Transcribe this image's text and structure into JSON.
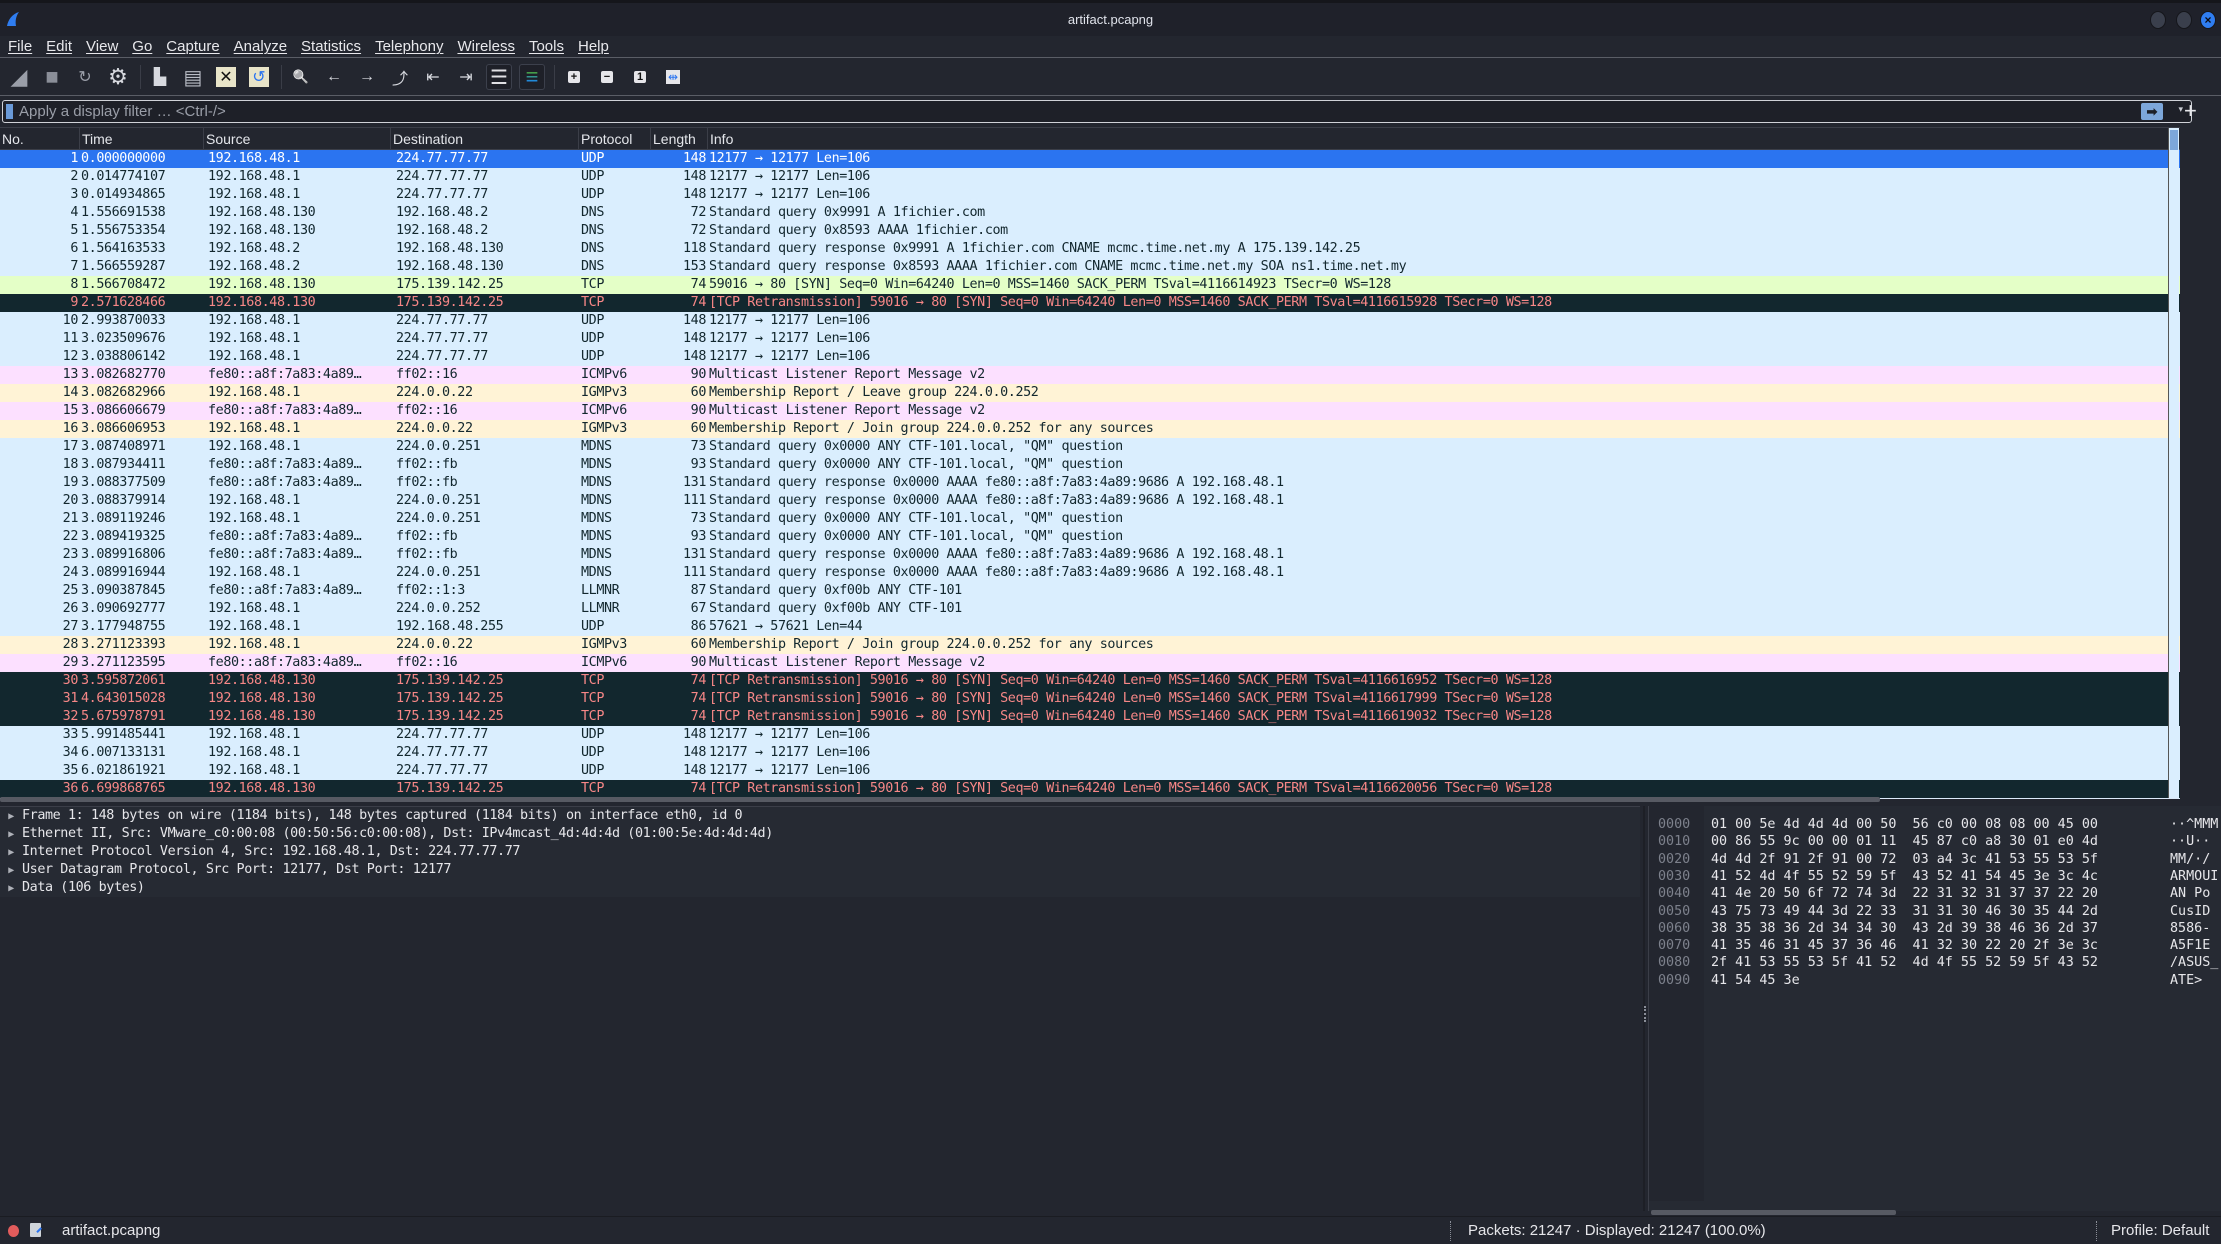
{
  "window": {
    "title": "artifact.pcapng"
  },
  "menu": [
    "File",
    "Edit",
    "View",
    "Go",
    "Capture",
    "Analyze",
    "Statistics",
    "Telephony",
    "Wireless",
    "Tools",
    "Help"
  ],
  "toolbar": [
    {
      "name": "start-capture-icon",
      "glyph": "◢"
    },
    {
      "name": "stop-capture-icon",
      "glyph": "■"
    },
    {
      "name": "restart-capture-icon",
      "glyph": "↻"
    },
    {
      "name": "capture-options-icon",
      "glyph": "⚙"
    },
    {
      "name": "open-file-icon",
      "glyph": "▙"
    },
    {
      "name": "save-file-icon",
      "glyph": "▤"
    },
    {
      "name": "close-file-icon",
      "glyph": "✕"
    },
    {
      "name": "reload-file-icon",
      "glyph": "↺"
    },
    {
      "name": "find-packet-icon",
      "glyph": "🔍"
    },
    {
      "name": "go-back-icon",
      "glyph": "←"
    },
    {
      "name": "go-forward-icon",
      "glyph": "→"
    },
    {
      "name": "go-to-packet-icon",
      "glyph": "⤴"
    },
    {
      "name": "go-first-packet-icon",
      "glyph": "⇤"
    },
    {
      "name": "go-last-packet-icon",
      "glyph": "⇥"
    },
    {
      "name": "autoscroll-icon",
      "glyph": "☰"
    },
    {
      "name": "colorize-icon",
      "glyph": "≡"
    },
    {
      "name": "zoom-in-icon",
      "glyph": "+"
    },
    {
      "name": "zoom-out-icon",
      "glyph": "−"
    },
    {
      "name": "zoom-normal-icon",
      "glyph": "1"
    },
    {
      "name": "resize-columns-icon",
      "glyph": "⇹"
    }
  ],
  "filter": {
    "placeholder": "Apply a display filter … <Ctrl-/>",
    "value": "",
    "apply_glyph": "➡",
    "dropdown_glyph": "▾",
    "add_glyph": "+"
  },
  "columns": [
    "No.",
    "Time",
    "Source",
    "Destination",
    "Protocol",
    "Length",
    "Info"
  ],
  "packets": [
    {
      "no": "1",
      "time": "0.000000000",
      "src": "192.168.48.1",
      "dst": "224.77.77.77",
      "proto": "UDP",
      "len": "148",
      "info": "12177 → 12177 Len=106",
      "cls": "udp sel"
    },
    {
      "no": "2",
      "time": "0.014774107",
      "src": "192.168.48.1",
      "dst": "224.77.77.77",
      "proto": "UDP",
      "len": "148",
      "info": "12177 → 12177 Len=106",
      "cls": "udp"
    },
    {
      "no": "3",
      "time": "0.014934865",
      "src": "192.168.48.1",
      "dst": "224.77.77.77",
      "proto": "UDP",
      "len": "148",
      "info": "12177 → 12177 Len=106",
      "cls": "udp"
    },
    {
      "no": "4",
      "time": "1.556691538",
      "src": "192.168.48.130",
      "dst": "192.168.48.2",
      "proto": "DNS",
      "len": "72",
      "info": "Standard query 0x9991 A 1fichier.com",
      "cls": "dns"
    },
    {
      "no": "5",
      "time": "1.556753354",
      "src": "192.168.48.130",
      "dst": "192.168.48.2",
      "proto": "DNS",
      "len": "72",
      "info": "Standard query 0x8593 AAAA 1fichier.com",
      "cls": "dns"
    },
    {
      "no": "6",
      "time": "1.564163533",
      "src": "192.168.48.2",
      "dst": "192.168.48.130",
      "proto": "DNS",
      "len": "118",
      "info": "Standard query response 0x9991 A 1fichier.com CNAME mcmc.time.net.my A 175.139.142.25",
      "cls": "dns"
    },
    {
      "no": "7",
      "time": "1.566559287",
      "src": "192.168.48.2",
      "dst": "192.168.48.130",
      "proto": "DNS",
      "len": "153",
      "info": "Standard query response 0x8593 AAAA 1fichier.com CNAME mcmc.time.net.my SOA ns1.time.net.my",
      "cls": "dns"
    },
    {
      "no": "8",
      "time": "1.566708472",
      "src": "192.168.48.130",
      "dst": "175.139.142.25",
      "proto": "TCP",
      "len": "74",
      "info": "59016 → 80 [SYN] Seq=0 Win=64240 Len=0 MSS=1460 SACK_PERM TSval=4116614923 TSecr=0 WS=128",
      "cls": "tcp"
    },
    {
      "no": "9",
      "time": "2.571628466",
      "src": "192.168.48.130",
      "dst": "175.139.142.25",
      "proto": "TCP",
      "len": "74",
      "info": "[TCP Retransmission] 59016 → 80 [SYN] Seq=0 Win=64240 Len=0 MSS=1460 SACK_PERM TSval=4116615928 TSecr=0 WS=128",
      "cls": "bad"
    },
    {
      "no": "10",
      "time": "2.993870033",
      "src": "192.168.48.1",
      "dst": "224.77.77.77",
      "proto": "UDP",
      "len": "148",
      "info": "12177 → 12177 Len=106",
      "cls": "udp"
    },
    {
      "no": "11",
      "time": "3.023509676",
      "src": "192.168.48.1",
      "dst": "224.77.77.77",
      "proto": "UDP",
      "len": "148",
      "info": "12177 → 12177 Len=106",
      "cls": "udp"
    },
    {
      "no": "12",
      "time": "3.038806142",
      "src": "192.168.48.1",
      "dst": "224.77.77.77",
      "proto": "UDP",
      "len": "148",
      "info": "12177 → 12177 Len=106",
      "cls": "udp"
    },
    {
      "no": "13",
      "time": "3.082682770",
      "src": "fe80::a8f:7a83:4a89…",
      "dst": "ff02::16",
      "proto": "ICMPv6",
      "len": "90",
      "info": "Multicast Listener Report Message v2",
      "cls": "icmpv6"
    },
    {
      "no": "14",
      "time": "3.082682966",
      "src": "192.168.48.1",
      "dst": "224.0.0.22",
      "proto": "IGMPv3",
      "len": "60",
      "info": "Membership Report / Leave group 224.0.0.252",
      "cls": "igmp"
    },
    {
      "no": "15",
      "time": "3.086606679",
      "src": "fe80::a8f:7a83:4a89…",
      "dst": "ff02::16",
      "proto": "ICMPv6",
      "len": "90",
      "info": "Multicast Listener Report Message v2",
      "cls": "icmpv6"
    },
    {
      "no": "16",
      "time": "3.086606953",
      "src": "192.168.48.1",
      "dst": "224.0.0.22",
      "proto": "IGMPv3",
      "len": "60",
      "info": "Membership Report / Join group 224.0.0.252 for any sources",
      "cls": "igmp"
    },
    {
      "no": "17",
      "time": "3.087408971",
      "src": "192.168.48.1",
      "dst": "224.0.0.251",
      "proto": "MDNS",
      "len": "73",
      "info": "Standard query 0x0000 ANY CTF-101.local, \"QM\" question",
      "cls": "mdns"
    },
    {
      "no": "18",
      "time": "3.087934411",
      "src": "fe80::a8f:7a83:4a89…",
      "dst": "ff02::fb",
      "proto": "MDNS",
      "len": "93",
      "info": "Standard query 0x0000 ANY CTF-101.local, \"QM\" question",
      "cls": "mdns"
    },
    {
      "no": "19",
      "time": "3.088377509",
      "src": "fe80::a8f:7a83:4a89…",
      "dst": "ff02::fb",
      "proto": "MDNS",
      "len": "131",
      "info": "Standard query response 0x0000 AAAA fe80::a8f:7a83:4a89:9686 A 192.168.48.1",
      "cls": "mdns"
    },
    {
      "no": "20",
      "time": "3.088379914",
      "src": "192.168.48.1",
      "dst": "224.0.0.251",
      "proto": "MDNS",
      "len": "111",
      "info": "Standard query response 0x0000 AAAA fe80::a8f:7a83:4a89:9686 A 192.168.48.1",
      "cls": "mdns"
    },
    {
      "no": "21",
      "time": "3.089119246",
      "src": "192.168.48.1",
      "dst": "224.0.0.251",
      "proto": "MDNS",
      "len": "73",
      "info": "Standard query 0x0000 ANY CTF-101.local, \"QM\" question",
      "cls": "mdns"
    },
    {
      "no": "22",
      "time": "3.089419325",
      "src": "fe80::a8f:7a83:4a89…",
      "dst": "ff02::fb",
      "proto": "MDNS",
      "len": "93",
      "info": "Standard query 0x0000 ANY CTF-101.local, \"QM\" question",
      "cls": "mdns"
    },
    {
      "no": "23",
      "time": "3.089916806",
      "src": "fe80::a8f:7a83:4a89…",
      "dst": "ff02::fb",
      "proto": "MDNS",
      "len": "131",
      "info": "Standard query response 0x0000 AAAA fe80::a8f:7a83:4a89:9686 A 192.168.48.1",
      "cls": "mdns"
    },
    {
      "no": "24",
      "time": "3.089916944",
      "src": "192.168.48.1",
      "dst": "224.0.0.251",
      "proto": "MDNS",
      "len": "111",
      "info": "Standard query response 0x0000 AAAA fe80::a8f:7a83:4a89:9686 A 192.168.48.1",
      "cls": "mdns"
    },
    {
      "no": "25",
      "time": "3.090387845",
      "src": "fe80::a8f:7a83:4a89…",
      "dst": "ff02::1:3",
      "proto": "LLMNR",
      "len": "87",
      "info": "Standard query 0xf00b ANY CTF-101",
      "cls": "llmnr"
    },
    {
      "no": "26",
      "time": "3.090692777",
      "src": "192.168.48.1",
      "dst": "224.0.0.252",
      "proto": "LLMNR",
      "len": "67",
      "info": "Standard query 0xf00b ANY CTF-101",
      "cls": "llmnr"
    },
    {
      "no": "27",
      "time": "3.177948755",
      "src": "192.168.48.1",
      "dst": "192.168.48.255",
      "proto": "UDP",
      "len": "86",
      "info": "57621 → 57621 Len=44",
      "cls": "udp"
    },
    {
      "no": "28",
      "time": "3.271123393",
      "src": "192.168.48.1",
      "dst": "224.0.0.22",
      "proto": "IGMPv3",
      "len": "60",
      "info": "Membership Report / Join group 224.0.0.252 for any sources",
      "cls": "igmp"
    },
    {
      "no": "29",
      "time": "3.271123595",
      "src": "fe80::a8f:7a83:4a89…",
      "dst": "ff02::16",
      "proto": "ICMPv6",
      "len": "90",
      "info": "Multicast Listener Report Message v2",
      "cls": "icmpv6"
    },
    {
      "no": "30",
      "time": "3.595872061",
      "src": "192.168.48.130",
      "dst": "175.139.142.25",
      "proto": "TCP",
      "len": "74",
      "info": "[TCP Retransmission] 59016 → 80 [SYN] Seq=0 Win=64240 Len=0 MSS=1460 SACK_PERM TSval=4116616952 TSecr=0 WS=128",
      "cls": "bad"
    },
    {
      "no": "31",
      "time": "4.643015028",
      "src": "192.168.48.130",
      "dst": "175.139.142.25",
      "proto": "TCP",
      "len": "74",
      "info": "[TCP Retransmission] 59016 → 80 [SYN] Seq=0 Win=64240 Len=0 MSS=1460 SACK_PERM TSval=4116617999 TSecr=0 WS=128",
      "cls": "bad"
    },
    {
      "no": "32",
      "time": "5.675978791",
      "src": "192.168.48.130",
      "dst": "175.139.142.25",
      "proto": "TCP",
      "len": "74",
      "info": "[TCP Retransmission] 59016 → 80 [SYN] Seq=0 Win=64240 Len=0 MSS=1460 SACK_PERM TSval=4116619032 TSecr=0 WS=128",
      "cls": "bad"
    },
    {
      "no": "33",
      "time": "5.991485441",
      "src": "192.168.48.1",
      "dst": "224.77.77.77",
      "proto": "UDP",
      "len": "148",
      "info": "12177 → 12177 Len=106",
      "cls": "udp"
    },
    {
      "no": "34",
      "time": "6.007133131",
      "src": "192.168.48.1",
      "dst": "224.77.77.77",
      "proto": "UDP",
      "len": "148",
      "info": "12177 → 12177 Len=106",
      "cls": "udp"
    },
    {
      "no": "35",
      "time": "6.021861921",
      "src": "192.168.48.1",
      "dst": "224.77.77.77",
      "proto": "UDP",
      "len": "148",
      "info": "12177 → 12177 Len=106",
      "cls": "udp"
    },
    {
      "no": "36",
      "time": "6.699868765",
      "src": "192.168.48.130",
      "dst": "175.139.142.25",
      "proto": "TCP",
      "len": "74",
      "info": "[TCP Retransmission] 59016 → 80 [SYN] Seq=0 Win=64240 Len=0 MSS=1460 SACK_PERM TSval=4116620056 TSecr=0 WS=128",
      "cls": "bad"
    }
  ],
  "details": [
    "Frame 1: 148 bytes on wire (1184 bits), 148 bytes captured (1184 bits) on interface eth0, id 0",
    "Ethernet II, Src: VMware_c0:00:08 (00:50:56:c0:00:08), Dst: IPv4mcast_4d:4d:4d (01:00:5e:4d:4d:4d)",
    "Internet Protocol Version 4, Src: 192.168.48.1, Dst: 224.77.77.77",
    "User Datagram Protocol, Src Port: 12177, Dst Port: 12177",
    "Data (106 bytes)"
  ],
  "bytes": [
    {
      "off": "0000",
      "hex": "01 00 5e 4d 4d 4d 00 50  56 c0 00 08 08 00 45 00",
      "ascii": "··^MMM"
    },
    {
      "off": "0010",
      "hex": "00 86 55 9c 00 00 01 11  45 87 c0 a8 30 01 e0 4d",
      "ascii": "··U··"
    },
    {
      "off": "0020",
      "hex": "4d 4d 2f 91 2f 91 00 72  03 a4 3c 41 53 55 53 5f",
      "ascii": "MM/·/"
    },
    {
      "off": "0030",
      "hex": "41 52 4d 4f 55 52 59 5f  43 52 41 54 45 3e 3c 4c",
      "ascii": "ARMOUI"
    },
    {
      "off": "0040",
      "hex": "41 4e 20 50 6f 72 74 3d  22 31 32 31 37 37 22 20",
      "ascii": "AN Po"
    },
    {
      "off": "0050",
      "hex": "43 75 73 49 44 3d 22 33  31 31 30 46 30 35 44 2d",
      "ascii": "CusID"
    },
    {
      "off": "0060",
      "hex": "38 35 38 36 2d 34 34 30  43 2d 39 38 46 36 2d 37",
      "ascii": "8586-"
    },
    {
      "off": "0070",
      "hex": "41 35 46 31 45 37 36 46  41 32 30 22 20 2f 3e 3c",
      "ascii": "A5F1E"
    },
    {
      "off": "0080",
      "hex": "2f 41 53 55 53 5f 41 52  4d 4f 55 52 59 5f 43 52",
      "ascii": "/ASUS_"
    },
    {
      "off": "0090",
      "hex": "41 54 45 3e",
      "ascii": "ATE>"
    }
  ],
  "status": {
    "file": "artifact.pcapng",
    "packets": "Packets: 21247 · Displayed: 21247 (100.0%)",
    "profile": "Profile: Default"
  }
}
